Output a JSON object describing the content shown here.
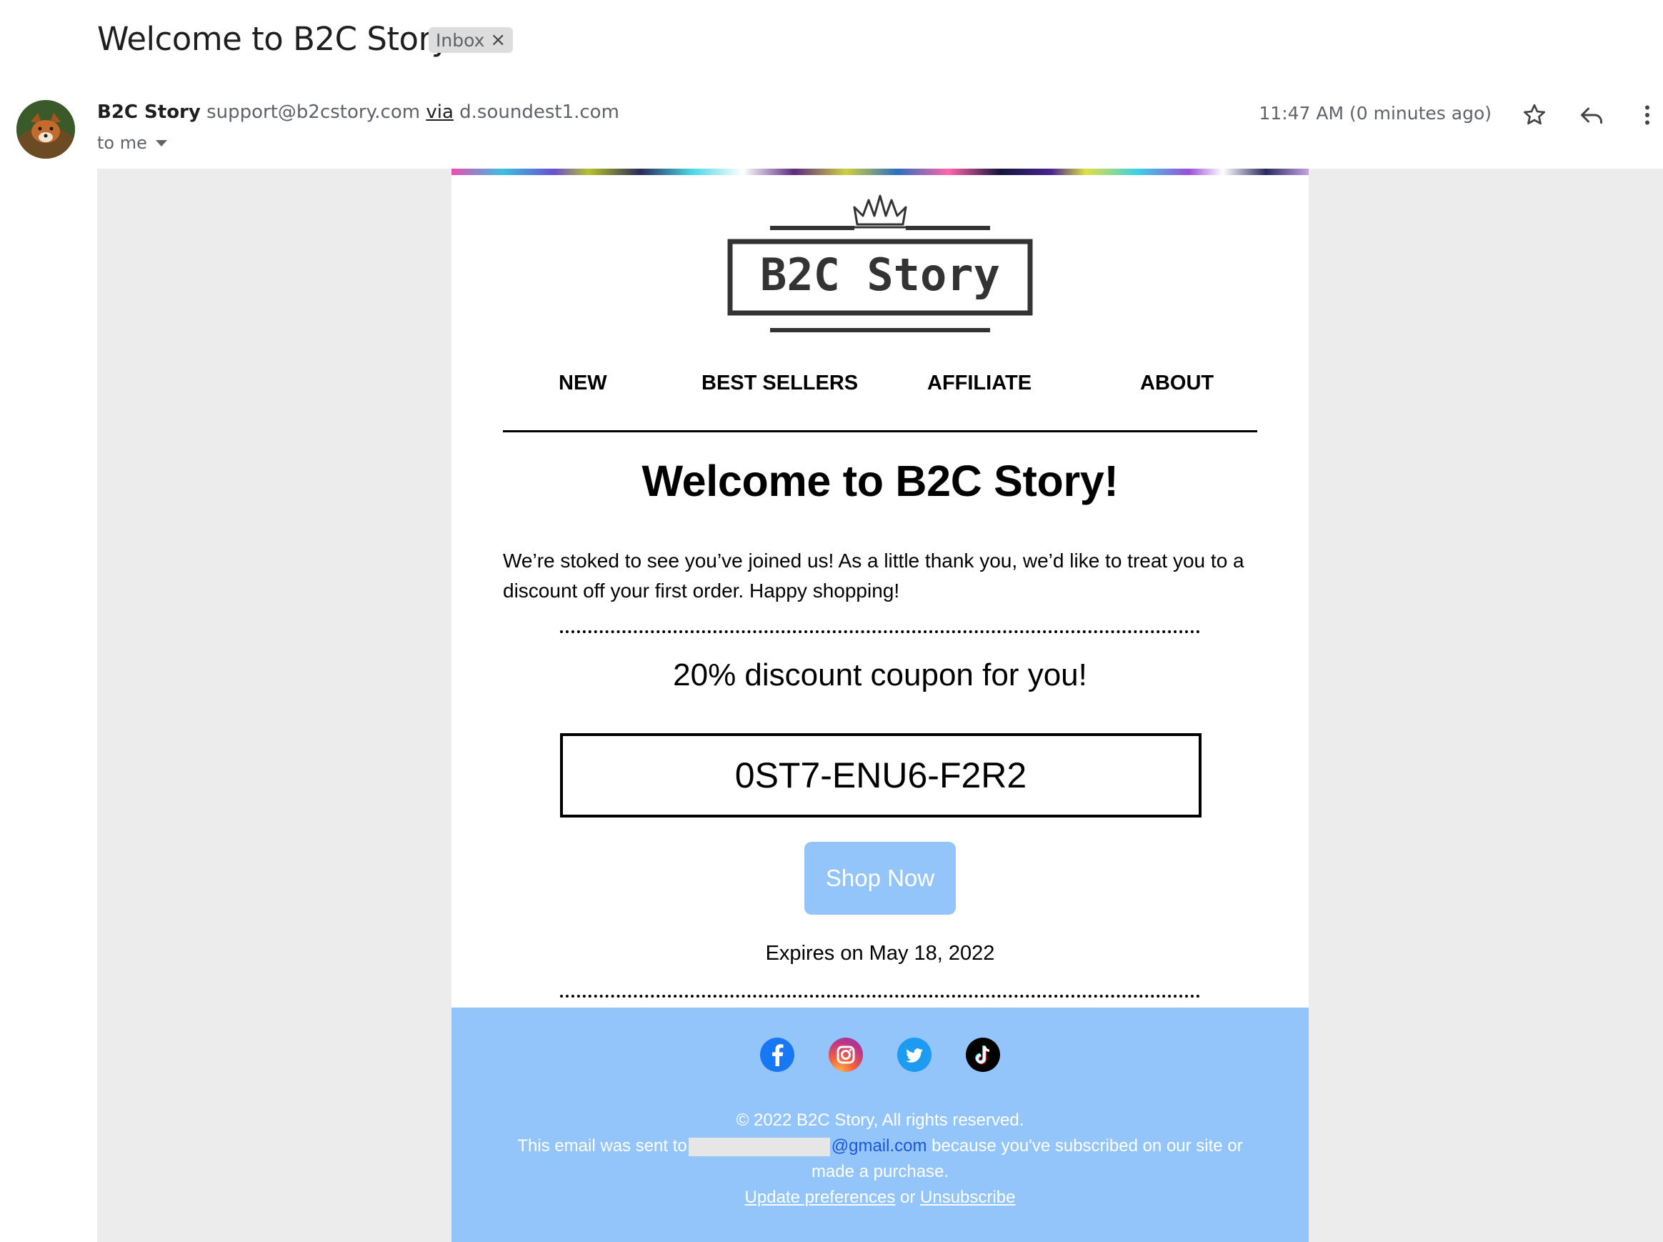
{
  "email": {
    "subject": "Welcome to B2C Story",
    "label_chip": "Inbox",
    "label_remove": "×",
    "sender_name": "B2C Story",
    "sender_email": "support@b2cstory.com",
    "via_label": "via",
    "via_domain": "d.soundest1.com",
    "to_label": "to me",
    "timestamp": "11:47 AM (0 minutes ago)",
    "icons": [
      "avatar-fox",
      "star-icon",
      "reply-icon",
      "more-vert-icon"
    ]
  },
  "newsletter": {
    "logo_text": "B2C Story",
    "nav": [
      "NEW",
      "BEST SELLERS",
      "AFFILIATE",
      "ABOUT"
    ],
    "headline": "Welcome to B2C Story!",
    "intro": "We’re stoked to see you’ve joined us! As a little thank you, we’d like to treat you to a discount off your first order. Happy shopping!",
    "coupon_title": "20% discount coupon for you!",
    "coupon_code": "0ST7-ENU6-F2R2",
    "cta_label": "Shop Now",
    "expires": "Expires on May 18, 2022",
    "social_icons": [
      "facebook-icon",
      "instagram-icon",
      "twitter-icon",
      "tiktok-icon"
    ],
    "footer": {
      "copyright": "© 2022 B2C Story, All rights reserved.",
      "sent_to_prefix": "This email was sent to",
      "email_domain": "@gmail.com",
      "sent_to_suffix": "because you've subscribed on our site or",
      "sent_to_line2": "made a purchase.",
      "update_prefs": "Update preferences",
      "or_label": "or",
      "unsubscribe": "Unsubscribe"
    },
    "colors": {
      "footer_bg": "#93c5fb",
      "button_bg": "#93c5fb",
      "canvas_bg": "#ececec",
      "link_blue": "#1a56d6"
    }
  }
}
